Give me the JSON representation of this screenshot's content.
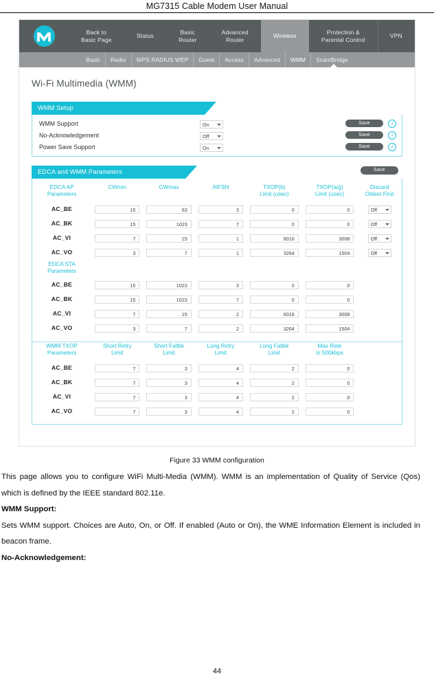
{
  "document": {
    "header_title": "MG7315 Cable Modem User Manual",
    "page_number": "44",
    "figure_caption": "Figure 33 WMM configuration"
  },
  "nav": {
    "logo_icon": "motorola-m-icon",
    "primary": [
      {
        "label": "Back to\nBasic Page",
        "active": false
      },
      {
        "label": "Status",
        "active": false
      },
      {
        "label": "Basic\nRouter",
        "active": false
      },
      {
        "label": "Advanced\nRouter",
        "active": false
      },
      {
        "label": "Wireless",
        "active": true
      },
      {
        "label": "Protection &\nParental Control",
        "active": false
      },
      {
        "label": "VPN",
        "active": false
      }
    ],
    "secondary": [
      {
        "label": "Basic",
        "active": false
      },
      {
        "label": "Radio",
        "active": false
      },
      {
        "label": "WPS RADIUS WEP",
        "active": false
      },
      {
        "label": "Guest",
        "active": false
      },
      {
        "label": "Access",
        "active": false
      },
      {
        "label": "Advanced",
        "active": false
      },
      {
        "label": "WMM",
        "active": true
      },
      {
        "label": "Scan/Bridge",
        "active": false
      }
    ]
  },
  "page": {
    "title": "Wi-Fi Multimedia (WMM)"
  },
  "wmm_setup": {
    "section_title": "WMM Setup",
    "save_label": "Save",
    "info_icon": "info-icon",
    "rows": [
      {
        "label": "WMM Support",
        "value": "On"
      },
      {
        "label": "No-Acknowledgement",
        "value": "Off"
      },
      {
        "label": "Power Save Support",
        "value": "On"
      }
    ]
  },
  "edca": {
    "section_title": "EDCA and WMM Parameters",
    "save_label": "Save",
    "ap_group_label": "EDCA AP\nParameters",
    "sta_group_label": "EDCA STA\nParameters",
    "columns": [
      "CWmin",
      "CWmax",
      "AIFSN",
      "TXOP(b)\nLimit (usec)",
      "TXOP(a/g)\nLimit (usec)",
      "Discard\nOldest First"
    ],
    "ap_rows": [
      {
        "name": "AC_BE",
        "cwmin": "15",
        "cwmax": "63",
        "aifsn": "3",
        "txop_b": "0",
        "txop_ag": "0",
        "discard": "Off"
      },
      {
        "name": "AC_BK",
        "cwmin": "15",
        "cwmax": "1023",
        "aifsn": "7",
        "txop_b": "0",
        "txop_ag": "0",
        "discard": "Off"
      },
      {
        "name": "AC_VI",
        "cwmin": "7",
        "cwmax": "15",
        "aifsn": "1",
        "txop_b": "6016",
        "txop_ag": "3008",
        "discard": "Off"
      },
      {
        "name": "AC_VO",
        "cwmin": "3",
        "cwmax": "7",
        "aifsn": "1",
        "txop_b": "3264",
        "txop_ag": "1504",
        "discard": "Off"
      }
    ],
    "sta_rows": [
      {
        "name": "AC_BE",
        "cwmin": "15",
        "cwmax": "1023",
        "aifsn": "3",
        "txop_b": "0",
        "txop_ag": "0"
      },
      {
        "name": "AC_BK",
        "cwmin": "15",
        "cwmax": "1023",
        "aifsn": "7",
        "txop_b": "0",
        "txop_ag": "0"
      },
      {
        "name": "AC_VI",
        "cwmin": "7",
        "cwmax": "15",
        "aifsn": "2",
        "txop_b": "6016",
        "txop_ag": "3008"
      },
      {
        "name": "AC_VO",
        "cwmin": "3",
        "cwmax": "7",
        "aifsn": "2",
        "txop_b": "3264",
        "txop_ag": "1504"
      }
    ],
    "txop_group_label": "WMM TXOP\nParameters",
    "txop_columns": [
      "Short Retry\nLimit",
      "Short Fallbk\nLimit",
      "Long Retry\nLimit",
      "Long Fallbk\nLimit",
      "Max Rate\nin 500kbps"
    ],
    "txop_rows": [
      {
        "name": "AC_BE",
        "short_retry": "7",
        "short_fallbk": "3",
        "long_retry": "4",
        "long_fallbk": "2",
        "max_rate": "0"
      },
      {
        "name": "AC_BK",
        "short_retry": "7",
        "short_fallbk": "3",
        "long_retry": "4",
        "long_fallbk": "2",
        "max_rate": "0"
      },
      {
        "name": "AC_VI",
        "short_retry": "7",
        "short_fallbk": "3",
        "long_retry": "4",
        "long_fallbk": "2",
        "max_rate": "0"
      },
      {
        "name": "AC_VO",
        "short_retry": "7",
        "short_fallbk": "3",
        "long_retry": "4",
        "long_fallbk": "2",
        "max_rate": "0"
      }
    ]
  },
  "prose": {
    "intro": "This page allows you to configure WiFi Multi-Media (WMM). WMM is an implementation of Quality of Service (Qos) which is defined by the IEEE standard 802.11e.",
    "heading_1": "WMM Support:",
    "body_1": "Sets WMM support. Choices are Auto, On, or Off. If enabled (Auto or On), the WME Information Element is included in beacon frame.",
    "heading_2": "No-Acknowledgement:"
  },
  "colors": {
    "accent_cyan": "#17bfd6",
    "nav_dark": "#575c5e",
    "nav_light": "#95999b",
    "save_gray": "#5c6365"
  }
}
